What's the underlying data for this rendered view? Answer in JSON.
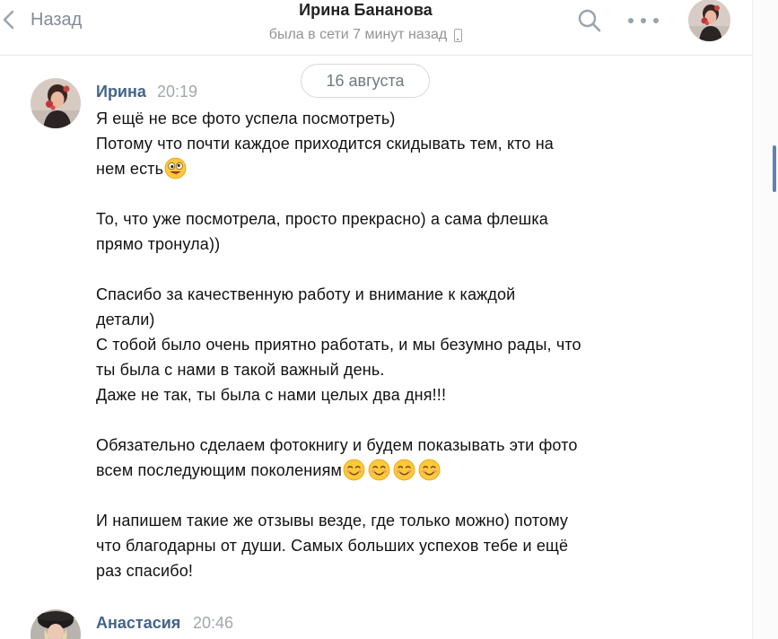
{
  "header": {
    "back_label": "Назад",
    "contact_name": "Ирина Бананова",
    "status": "была в сети 7 минут назад"
  },
  "icons": {
    "back": "chevron-left-icon",
    "search": "search-icon",
    "more": "more-horizontal-icon",
    "device": "mobile-phone-icon"
  },
  "date_separator": "16 августа",
  "messages": [
    {
      "author": "Ирина",
      "time": "20:19",
      "lines": [
        "Я ещё не все фото успела посмотреть)",
        "Потому что почти каждое приходится скидывать тем, кто на",
        "нем есть",
        "",
        "То, что уже посмотрела, просто прекрасно) а сама флешка",
        "прямо тронула))",
        "",
        "Спасибо за качественную работу и внимание к каждой",
        "детали)",
        "С тобой было очень приятно работать, и мы безумно рады, что",
        "ты была с нами в такой важный день.",
        "Даже не так, ты была с нами целых два дня!!!",
        "",
        "Обязательно сделаем фотокнигу и будем показывать эти фото",
        "всем последующим поколениям",
        "",
        "И напишем такие же отзывы везде, где только можно) потому",
        "что благодарны от души. Самых больших успехов тебе и ещё",
        "раз спасибо!"
      ]
    },
    {
      "author": "Анастасия",
      "time": "20:46"
    }
  ],
  "colors": {
    "author_link": "#42648b",
    "muted_text": "#828a99",
    "scroll_thumb": "#5b84b5",
    "emoji_yellow": "#ffc83d"
  }
}
